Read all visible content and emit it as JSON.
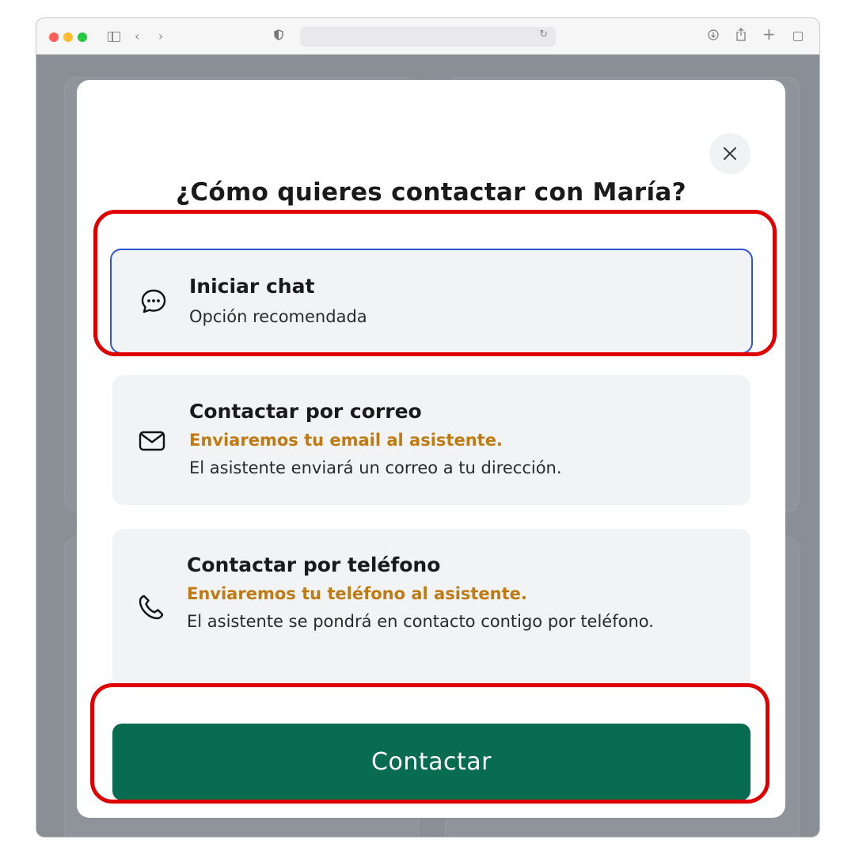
{
  "browser": {
    "address_text": ""
  },
  "modal": {
    "title": "¿Cómo quieres contactar con María?",
    "options": [
      {
        "title": "Iniciar chat",
        "subtitle": "Opción recomendada",
        "icon": "chat-bubble-icon",
        "selected": true
      },
      {
        "title": "Contactar por correo",
        "warning": "Enviaremos tu email al asistente.",
        "description": "El asistente enviará un correo a tu dirección.",
        "icon": "mail-icon",
        "selected": false
      },
      {
        "title": "Contactar por teléfono",
        "warning": "Enviaremos tu teléfono al asistente.",
        "description": "El asistente se pondrá en contacto contigo por teléfono.",
        "icon": "phone-icon",
        "selected": false
      }
    ],
    "submit_label": "Contactar"
  },
  "colors": {
    "primary_button": "#076c50",
    "selected_border": "#2f55d4",
    "warning_text": "#c07a12",
    "highlight": "#e10000"
  }
}
